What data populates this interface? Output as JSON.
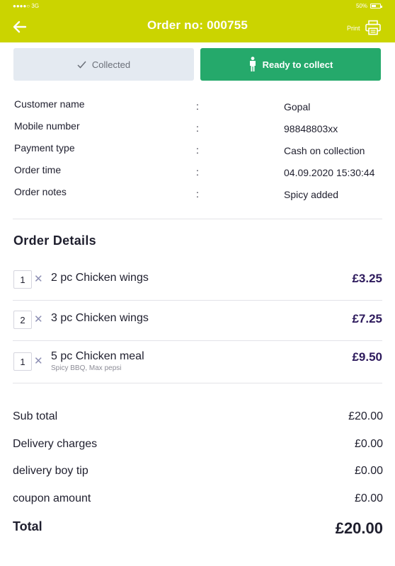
{
  "status_bar": {
    "carrier": "●●●●○ 3G",
    "battery": "50%"
  },
  "header": {
    "title": "Order no: 000755",
    "print_label": "Print"
  },
  "actions": {
    "collected_label": "Collected",
    "ready_label": "Ready to collect"
  },
  "customer_info": [
    {
      "label": "Customer name",
      "value": "Gopal"
    },
    {
      "label": "Mobile number",
      "value": "98848803xx"
    },
    {
      "label": "Payment type",
      "value": "Cash on collection"
    },
    {
      "label": "Order time",
      "value": "04.09.2020  15:30:44"
    },
    {
      "label": "Order notes",
      "value": "Spicy added"
    }
  ],
  "order_details": {
    "title": "Order Details",
    "items": [
      {
        "qty": "1",
        "name": "2 pc Chicken wings",
        "note": "",
        "price": "£3.25"
      },
      {
        "qty": "2",
        "name": "3 pc Chicken wings",
        "note": "",
        "price": "£7.25"
      },
      {
        "qty": "1",
        "name": "5 pc Chicken meal",
        "note": "Spicy BBQ, Max pepsi",
        "price": "£9.50"
      }
    ]
  },
  "summary": [
    {
      "label": "Sub total",
      "value": "£20.00"
    },
    {
      "label": "Delivery charges",
      "value": "£0.00"
    },
    {
      "label": "delivery boy tip",
      "value": "£0.00"
    },
    {
      "label": "coupon amount",
      "value": "£0.00"
    }
  ],
  "total": {
    "label": "Total",
    "value": "£20.00"
  },
  "colors": {
    "header": "#cbd400",
    "ready_button": "#25a96b",
    "collected_button": "#e4eaf1",
    "price": "#2d1a5c"
  }
}
